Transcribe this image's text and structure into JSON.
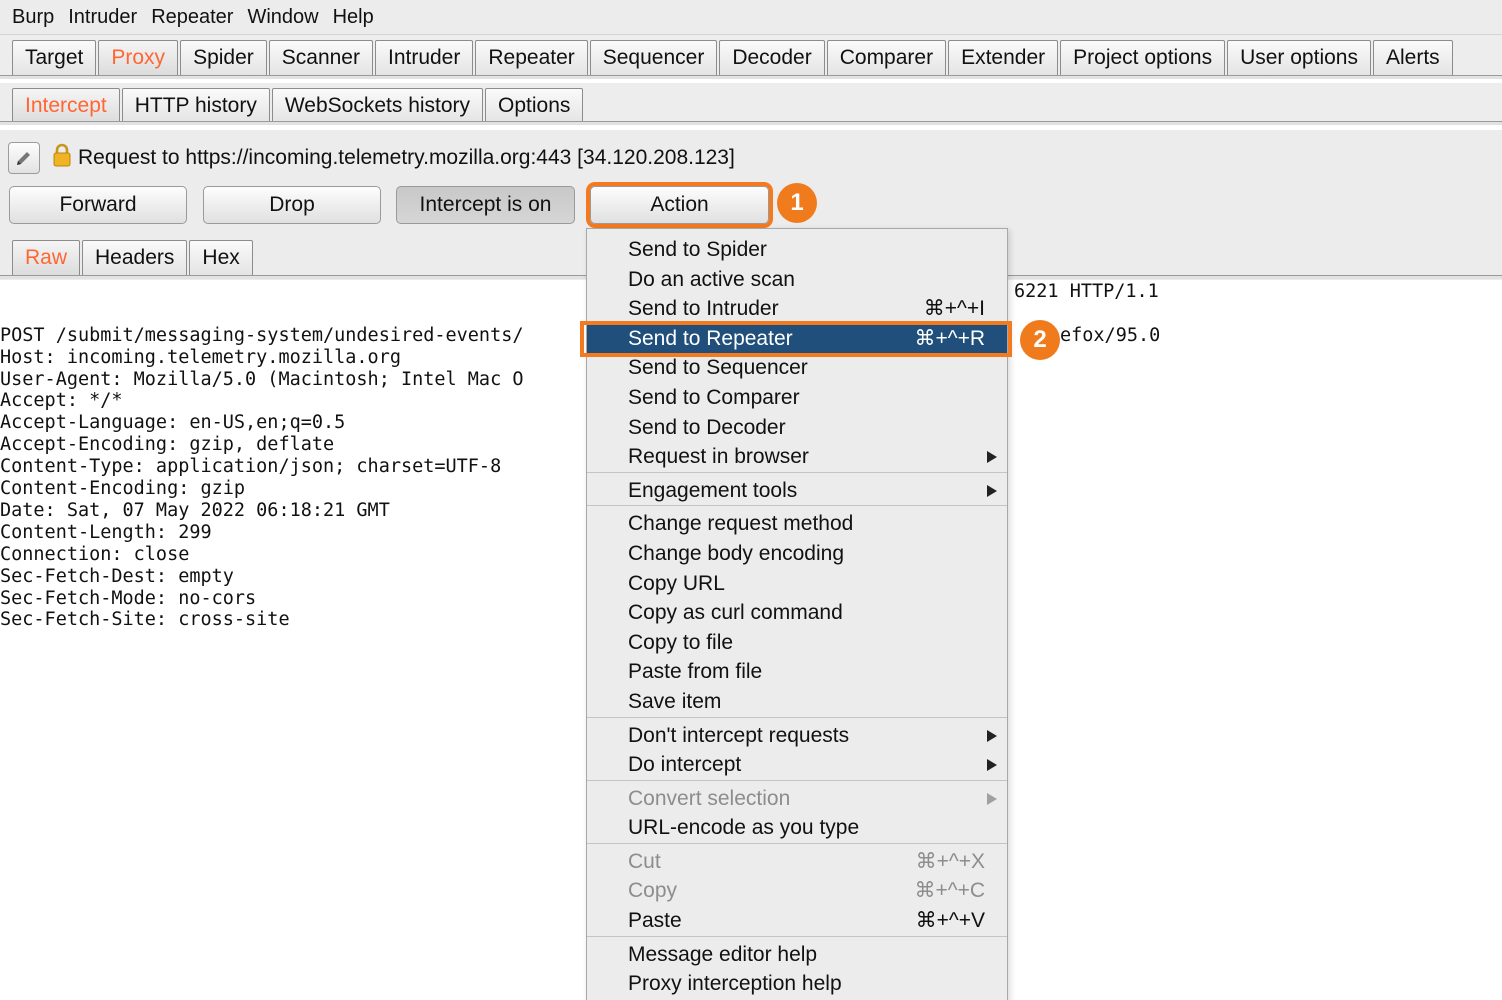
{
  "menubar": [
    "Burp",
    "Intruder",
    "Repeater",
    "Window",
    "Help"
  ],
  "main_tabs": [
    {
      "label": "Target"
    },
    {
      "label": "Proxy",
      "active": true
    },
    {
      "label": "Spider"
    },
    {
      "label": "Scanner"
    },
    {
      "label": "Intruder"
    },
    {
      "label": "Repeater"
    },
    {
      "label": "Sequencer"
    },
    {
      "label": "Decoder"
    },
    {
      "label": "Comparer"
    },
    {
      "label": "Extender"
    },
    {
      "label": "Project options"
    },
    {
      "label": "User options"
    },
    {
      "label": "Alerts"
    }
  ],
  "proxy_tabs": [
    {
      "label": "Intercept",
      "active": true
    },
    {
      "label": "HTTP history"
    },
    {
      "label": "WebSockets history"
    },
    {
      "label": "Options"
    }
  ],
  "intercept": {
    "request_line": "Request to https://incoming.telemetry.mozilla.org:443  [34.120.208.123]",
    "forward": "Forward",
    "drop": "Drop",
    "intercept_toggle": "Intercept is on",
    "action": "Action"
  },
  "badges": {
    "one": "1",
    "two": "2"
  },
  "message_tabs": [
    {
      "label": "Raw",
      "active": true
    },
    {
      "label": "Headers"
    },
    {
      "label": "Hex"
    }
  ],
  "request_lines": [
    "POST /submit/messaging-system/undesired-events/",
    "Host: incoming.telemetry.mozilla.org",
    "User-Agent: Mozilla/5.0 (Macintosh; Intel Mac O",
    "Accept: */*",
    "Accept-Language: en-US,en;q=0.5",
    "Accept-Encoding: gzip, deflate",
    "Content-Type: application/json; charset=UTF-8",
    "Content-Encoding: gzip",
    "Date: Sat, 07 May 2022 06:18:21 GMT",
    "Content-Length: 299",
    "Connection: close",
    "Sec-Fetch-Dest: empty",
    "Sec-Fetch-Mode: no-cors",
    "Sec-Fetch-Site: cross-site"
  ],
  "request_tail_fragments": [
    "6221 HTTP/1.1",
    "efox/95.0"
  ],
  "action_menu": [
    {
      "label": "Send to Spider"
    },
    {
      "label": "Do an active scan"
    },
    {
      "label": "Send to Intruder",
      "shortcut": "⌘+^+I"
    },
    {
      "label": "Send to Repeater",
      "shortcut": "⌘+^+R",
      "highlighted": true
    },
    {
      "label": "Send to Sequencer"
    },
    {
      "label": "Send to Comparer"
    },
    {
      "label": "Send to Decoder"
    },
    {
      "label": "Request in browser",
      "submenu": true
    },
    {
      "separator": true
    },
    {
      "label": "Engagement tools",
      "submenu": true
    },
    {
      "separator": true
    },
    {
      "label": "Change request method"
    },
    {
      "label": "Change body encoding"
    },
    {
      "label": "Copy URL"
    },
    {
      "label": "Copy as curl command"
    },
    {
      "label": "Copy to file"
    },
    {
      "label": "Paste from file"
    },
    {
      "label": "Save item"
    },
    {
      "separator": true
    },
    {
      "label": "Don't intercept requests",
      "submenu": true
    },
    {
      "label": "Do intercept",
      "submenu": true
    },
    {
      "separator": true
    },
    {
      "label": "Convert selection",
      "submenu": true,
      "disabled": true
    },
    {
      "label": "URL-encode as you type"
    },
    {
      "separator": true
    },
    {
      "label": "Cut",
      "shortcut": "⌘+^+X",
      "disabled": true
    },
    {
      "label": "Copy",
      "shortcut": "⌘+^+C",
      "disabled": true
    },
    {
      "label": "Paste",
      "shortcut": "⌘+^+V"
    },
    {
      "separator": true
    },
    {
      "label": "Message editor help"
    },
    {
      "label": "Proxy interception help"
    }
  ],
  "colors": {
    "accent_orange": "#f47a20",
    "active_tab_text": "#ff6633",
    "menu_highlight": "#1f4f7a"
  }
}
